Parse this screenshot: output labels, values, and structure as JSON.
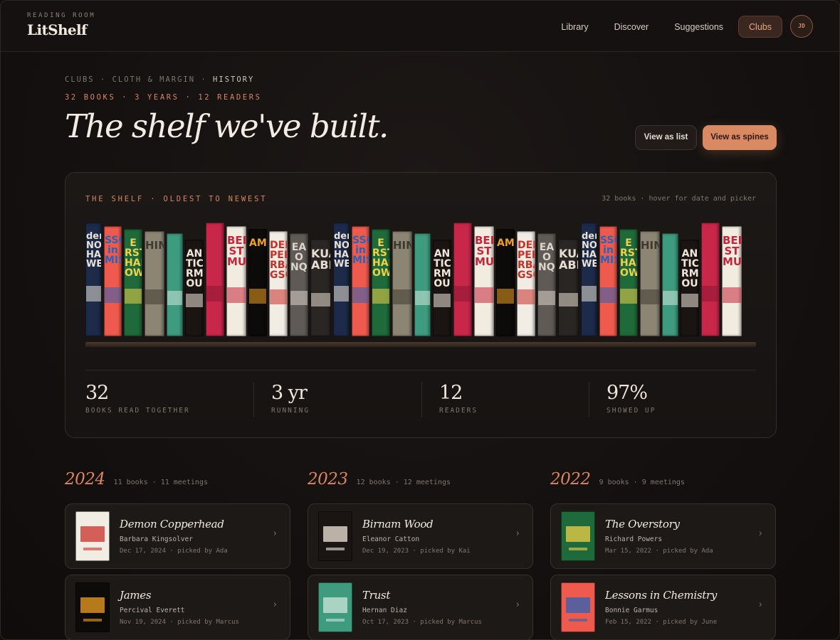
{
  "header": {
    "kicker": "READING ROOM",
    "brand": "LitShelf",
    "nav": [
      {
        "label": "Library",
        "active": false
      },
      {
        "label": "Discover",
        "active": false
      },
      {
        "label": "Suggestions",
        "active": false
      },
      {
        "label": "Clubs",
        "active": true
      }
    ],
    "avatar_initials": "JD"
  },
  "breadcrumb": {
    "parts": "CLUBS · CLOTH & MARGIN · ",
    "current": "HISTORY"
  },
  "summary": "32 BOOKS · 3 YEARS · 12 READERS",
  "title": "The shelf we've built.",
  "view_toggle": {
    "list_label": "View as list",
    "spines_label": "View as spines",
    "selected": "spines"
  },
  "shelf": {
    "title": "THE SHELF · OLDEST TO NEWEST",
    "note": "32 books · hover for date and picker",
    "spines": [
      {
        "text": "der NOV HA WE",
        "bg": "#1d2a4a",
        "accent": "#e9e2d6"
      },
      {
        "text": "SSO in MIS",
        "bg": "#ef5a4e",
        "accent": "#2a63b7"
      },
      {
        "text": "E RST HAI OW",
        "bg": "#1f6a3a",
        "accent": "#f0d14a"
      },
      {
        "text": "HIN",
        "bg": "#8d8574",
        "accent": "#3e3a30"
      },
      {
        "text": "",
        "bg": "#3e9b7e",
        "accent": "#cfe6dc"
      },
      {
        "text": "AN TIC RM OU",
        "bg": "#1a1512",
        "accent": "#f0e7da"
      },
      {
        "text": "",
        "bg": "#c8274a",
        "accent": "#8a1730"
      },
      {
        "text": "BEE ST MUR",
        "bg": "#f2ece0",
        "accent": "#c6243a"
      },
      {
        "text": "AM",
        "bg": "#0d0b0a",
        "accent": "#f0a020"
      },
      {
        "text": "DEMO PERH RBAR GSOL",
        "bg": "#f1ece4",
        "accent": "#c8302a"
      },
      {
        "text": "EA O NQUI",
        "bg": "#5f5a55",
        "accent": "#dcd5cc"
      },
      {
        "text": "KUA ABE",
        "bg": "#2a2624",
        "accent": "#e6ded2"
      },
      {
        "text": "der NOV HA WE",
        "bg": "#1d2a4a",
        "accent": "#e9e2d6"
      },
      {
        "text": "SSO in MIS",
        "bg": "#ef5a4e",
        "accent": "#2a63b7"
      },
      {
        "text": "E RST HAI OW",
        "bg": "#1f6a3a",
        "accent": "#f0d14a"
      },
      {
        "text": "HIN",
        "bg": "#8d8574",
        "accent": "#3e3a30"
      },
      {
        "text": "",
        "bg": "#3e9b7e",
        "accent": "#cfe6dc"
      },
      {
        "text": "AN TIC RM OU",
        "bg": "#1a1512",
        "accent": "#f0e7da"
      },
      {
        "text": "",
        "bg": "#c8274a",
        "accent": "#8a1730"
      },
      {
        "text": "BEE ST MUR",
        "bg": "#f2ece0",
        "accent": "#c6243a"
      },
      {
        "text": "AM",
        "bg": "#0d0b0a",
        "accent": "#f0a020"
      },
      {
        "text": "DEMO PERH RBAR GSOL",
        "bg": "#f1ece4",
        "accent": "#c8302a"
      },
      {
        "text": "EA O NQUI",
        "bg": "#5f5a55",
        "accent": "#dcd5cc"
      },
      {
        "text": "KUA ABE",
        "bg": "#2a2624",
        "accent": "#e6ded2"
      },
      {
        "text": "der NOV HA WE",
        "bg": "#1d2a4a",
        "accent": "#e9e2d6"
      },
      {
        "text": "SSO in MIS",
        "bg": "#ef5a4e",
        "accent": "#2a63b7"
      },
      {
        "text": "E RST HAI OW",
        "bg": "#1f6a3a",
        "accent": "#f0d14a"
      },
      {
        "text": "HIN",
        "bg": "#8d8574",
        "accent": "#3e3a30"
      },
      {
        "text": "",
        "bg": "#3e9b7e",
        "accent": "#cfe6dc"
      },
      {
        "text": "AN TIC RM OU",
        "bg": "#1a1512",
        "accent": "#f0e7da"
      },
      {
        "text": "",
        "bg": "#c8274a",
        "accent": "#8a1730"
      },
      {
        "text": "BEE ST MUR",
        "bg": "#f2ece0",
        "accent": "#c6243a"
      }
    ]
  },
  "stats": [
    {
      "value": "32",
      "label": "BOOKS READ TOGETHER"
    },
    {
      "value": "3 yr",
      "label": "RUNNING"
    },
    {
      "value": "12",
      "label": "READERS"
    },
    {
      "value": "97%",
      "label": "SHOWED UP"
    }
  ],
  "years": [
    {
      "year": "2024",
      "meta": "11 books · 11 meetings",
      "books": [
        {
          "title": "Demon Copperhead",
          "author": "Barbara Kingsolver",
          "date": "Dec 17, 2024 · picked by Ada",
          "cover_bg": "#f1ece4",
          "cover_accent": "#c8302a"
        },
        {
          "title": "James",
          "author": "Percival Everett",
          "date": "Nov 19, 2024 · picked by Marcus",
          "cover_bg": "#0d0b0a",
          "cover_accent": "#f0a020"
        }
      ]
    },
    {
      "year": "2023",
      "meta": "12 books · 12 meetings",
      "books": [
        {
          "title": "Birnam Wood",
          "author": "Eleanor Catton",
          "date": "Dec 19, 2023 · picked by Kai",
          "cover_bg": "#1a1512",
          "cover_accent": "#f0e7da"
        },
        {
          "title": "Trust",
          "author": "Hernan Diaz",
          "date": "Oct 17, 2023 · picked by Marcus",
          "cover_bg": "#3e9b7e",
          "cover_accent": "#cfe6dc"
        }
      ]
    },
    {
      "year": "2022",
      "meta": "9 books · 9 meetings",
      "books": [
        {
          "title": "The Overstory",
          "author": "Richard Powers",
          "date": "Mar 15, 2022 · picked by Ada",
          "cover_bg": "#1f6a3a",
          "cover_accent": "#f0d14a"
        },
        {
          "title": "Lessons in Chemistry",
          "author": "Bonnie Garmus",
          "date": "Feb 15, 2022 · picked by June",
          "cover_bg": "#ef5a4e",
          "cover_accent": "#2a63b7"
        }
      ]
    }
  ]
}
